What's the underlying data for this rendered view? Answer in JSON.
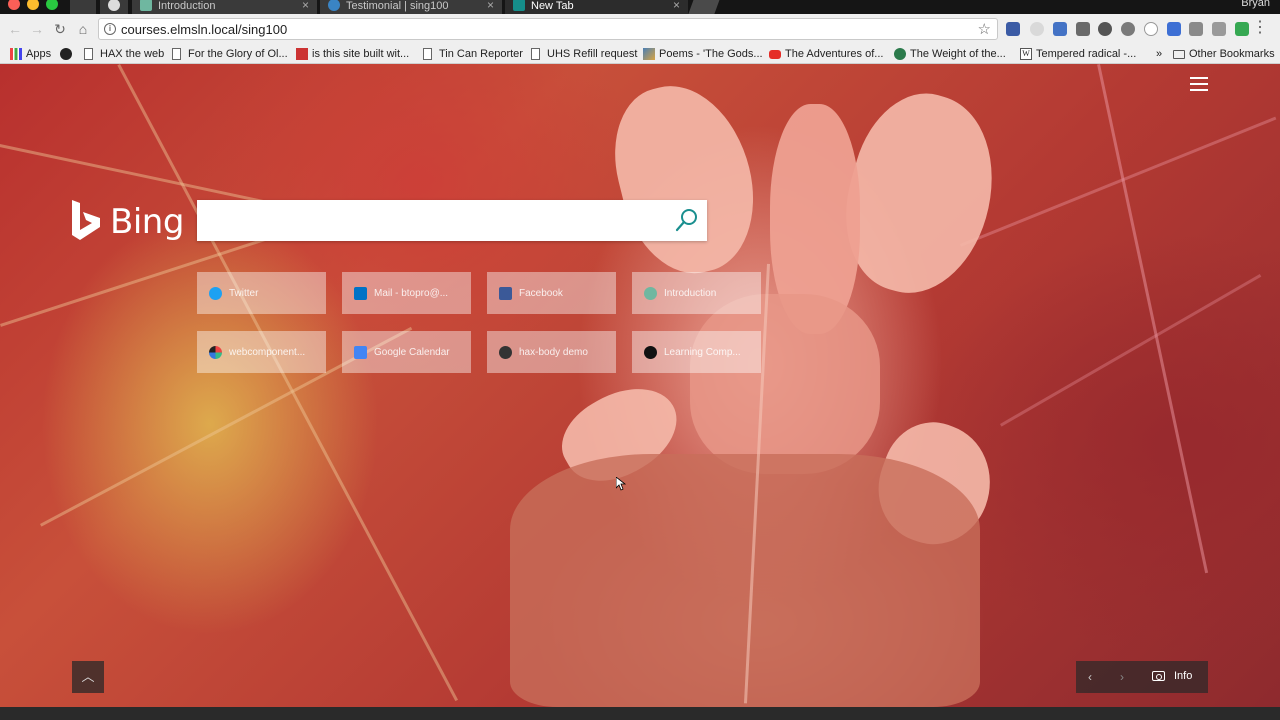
{
  "browser": {
    "tabs": [
      {
        "label": "Introduction",
        "favicon_color": "#6fb7a0"
      },
      {
        "label": "Testimonial | sing100",
        "favicon_color": "#3a84c4"
      },
      {
        "label": "New Tab",
        "favicon_color": "#158e8a"
      }
    ],
    "profile_name": "Bryan",
    "url": "courses.elmsln.local/sing100",
    "bookmarks": [
      {
        "label": "Apps",
        "icon": "apps-grid-icon"
      },
      {
        "label": "",
        "icon": "github-icon"
      },
      {
        "label": "HAX the web",
        "icon": "page-icon"
      },
      {
        "label": "For the Glory of Ol...",
        "icon": "page-icon"
      },
      {
        "label": "is this site built wit...",
        "icon": "wappalyzer-icon"
      },
      {
        "label": "Tin Can Reporter",
        "icon": "page-icon"
      },
      {
        "label": "UHS Refill request",
        "icon": "page-icon"
      },
      {
        "label": "Poems - 'The Gods...",
        "icon": "image-icon"
      },
      {
        "label": "The Adventures of...",
        "icon": "youtube-icon"
      },
      {
        "label": "The Weight of the...",
        "icon": "globe-icon"
      },
      {
        "label": "Tempered radical -...",
        "icon": "wikipedia-icon"
      },
      {
        "label": "»",
        "icon": "chevron-more-icon"
      },
      {
        "label": "Other Bookmarks",
        "icon": "folder-icon"
      }
    ]
  },
  "bing": {
    "logo_text": "Bing",
    "search_value": "",
    "tiles": [
      {
        "label": "Twitter",
        "icon_color": "#1da1f2",
        "icon": "twitter-icon"
      },
      {
        "label": "Mail - btopro@...",
        "icon_color": "#0072c6",
        "icon": "outlook-icon"
      },
      {
        "label": "Facebook",
        "icon_color": "#3b5998",
        "icon": "facebook-icon"
      },
      {
        "label": "Introduction",
        "icon_color": "#6fb7a0",
        "icon": "snowflake-icon"
      },
      {
        "label": "webcomponent...",
        "icon_color": "#222222",
        "icon": "webcomponents-icon"
      },
      {
        "label": "Google Calendar",
        "icon_color": "#4285f4",
        "icon": "calendar-icon"
      },
      {
        "label": "hax-body demo",
        "icon_color": "#333333",
        "icon": "hax-icon"
      },
      {
        "label": "Learning Comp...",
        "icon_color": "#111111",
        "icon": "github-icon"
      }
    ],
    "info_label": "Info"
  }
}
